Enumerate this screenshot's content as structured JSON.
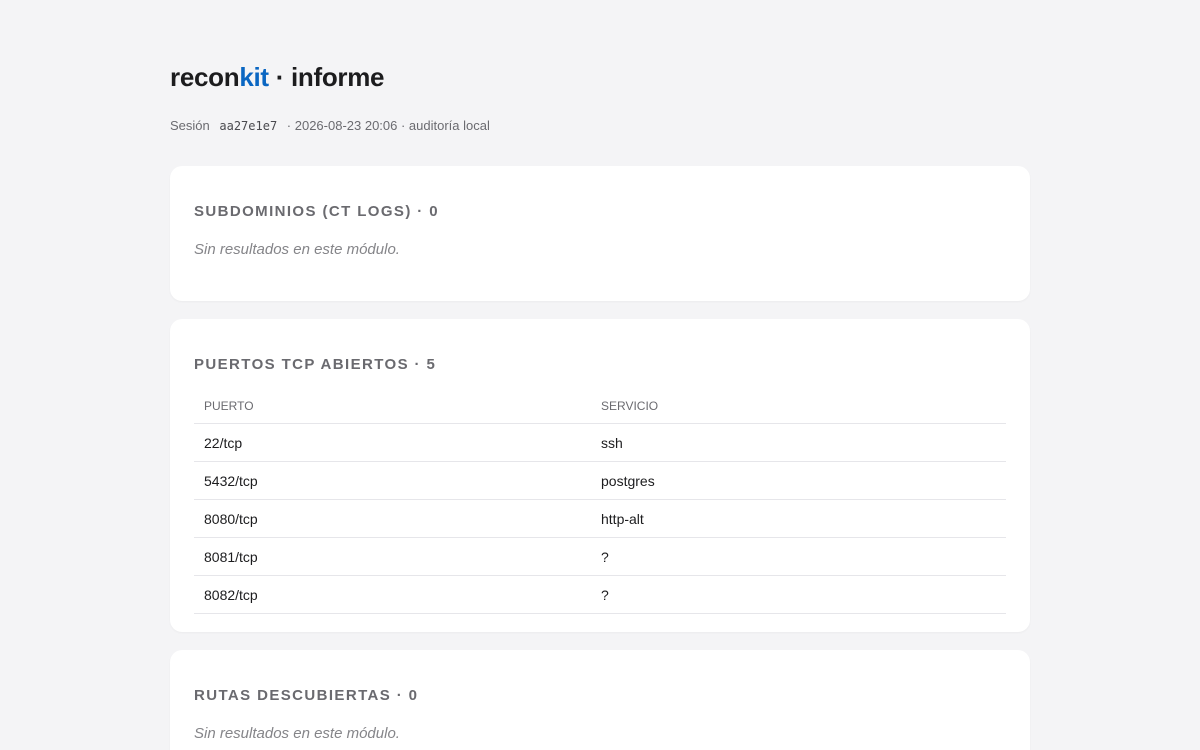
{
  "header": {
    "brand_prefix": "recon",
    "brand_accent": "kit",
    "title_suffix": " · informe",
    "session_label": "Sesión",
    "session_id": "aa27e1e7",
    "session_details": "· 2026-08-23 20:06 · auditoría local"
  },
  "colors": {
    "accent": "#0a66c2",
    "background": "#f4f4f6",
    "card": "#ffffff"
  },
  "sections": {
    "subdomains": {
      "title": "SUBDOMINIOS (CT LOGS) · 0",
      "empty_text": "Sin resultados en este módulo."
    },
    "ports": {
      "title": "PUERTOS TCP ABIERTOS · 5",
      "columns": [
        "PUERTO",
        "SERVICIO"
      ],
      "rows": [
        {
          "port": "22/tcp",
          "service": "ssh"
        },
        {
          "port": "5432/tcp",
          "service": "postgres"
        },
        {
          "port": "8080/tcp",
          "service": "http-alt"
        },
        {
          "port": "8081/tcp",
          "service": "?"
        },
        {
          "port": "8082/tcp",
          "service": "?"
        }
      ]
    },
    "routes": {
      "title": "RUTAS DESCUBIERTAS · 0",
      "empty_text": "Sin resultados en este módulo."
    }
  }
}
